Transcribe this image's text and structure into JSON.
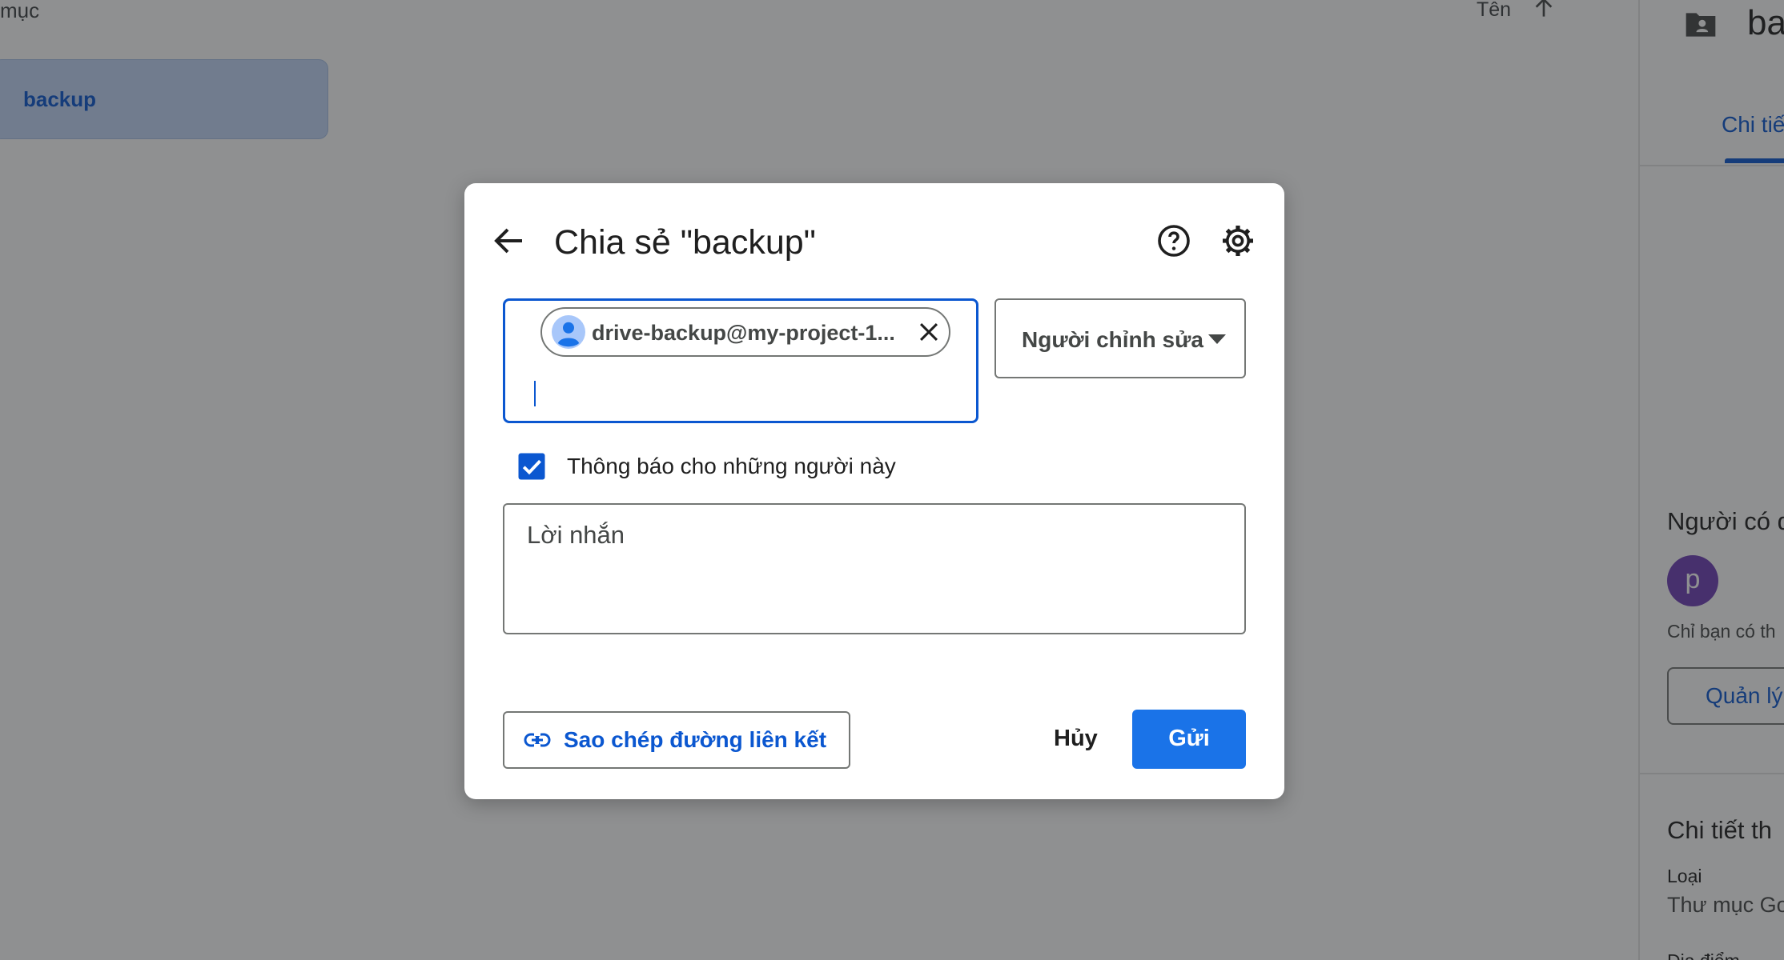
{
  "background": {
    "breadcrumb": "mục",
    "sort_label": "Tên",
    "folder_chip_label": "backup",
    "right_panel": {
      "name": "ba",
      "tab": "Chi tiế",
      "who_has_access": "Người có q",
      "avatar_letter": "p",
      "only_you": "Chỉ bạn có th",
      "manage_button": "Quản lý",
      "details_heading": "Chi tiết th",
      "type_label": "Loại",
      "type_value": "Thư mục Go",
      "location_label": "Địa điểm"
    }
  },
  "dialog": {
    "title": "Chia sẻ \"backup\"",
    "recipient_chip": "drive-backup@my-project-1...",
    "role": "Người chỉnh sửa",
    "notify_label": "Thông báo cho những người này",
    "notify_checked": true,
    "message_placeholder": "Lời nhắn",
    "copy_link_label": "Sao chép đường liên kết",
    "cancel_label": "Hủy",
    "send_label": "Gửi"
  },
  "colors": {
    "accent": "#0b57d0",
    "primary_button": "#1a73e8",
    "avatar": "#6f3fb6"
  }
}
